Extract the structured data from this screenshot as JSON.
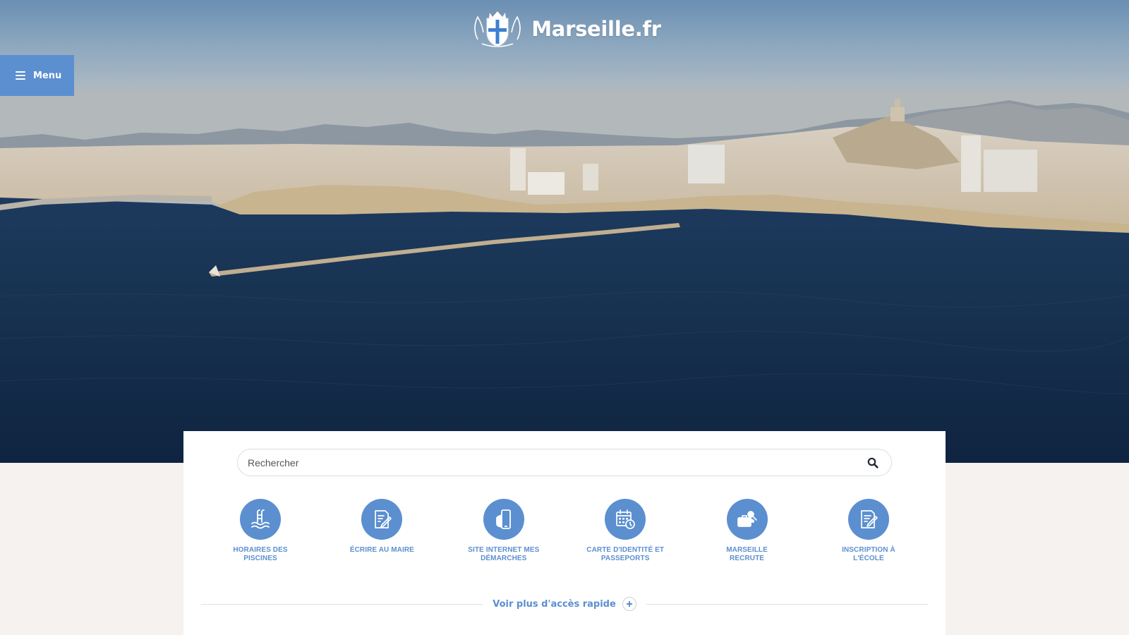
{
  "brand": {
    "site_name": "Marseille.fr",
    "crest_icon": "marseille-coat-of-arms",
    "accent_color": "#5b8fd0"
  },
  "nav": {
    "menu_label": "Menu",
    "menu_icon": "hamburger-icon"
  },
  "search": {
    "placeholder": "Rechercher",
    "value": "",
    "icon": "search-icon"
  },
  "quick_access": {
    "items": [
      {
        "label": "Horaires des piscines",
        "icon": "swimming-pool-icon"
      },
      {
        "label": "Écrire au maire",
        "icon": "write-letter-icon"
      },
      {
        "label": "Site internet mes démarches",
        "icon": "mobile-phone-icon"
      },
      {
        "label": "Carte d'identité et passeports",
        "icon": "calendar-clock-icon"
      },
      {
        "label": "Marseille recrute",
        "icon": "job-briefcase-icon"
      },
      {
        "label": "Inscription à l'école",
        "icon": "form-edit-icon"
      }
    ],
    "more_label": "Voir plus d'accès rapide",
    "more_icon": "plus-icon"
  }
}
